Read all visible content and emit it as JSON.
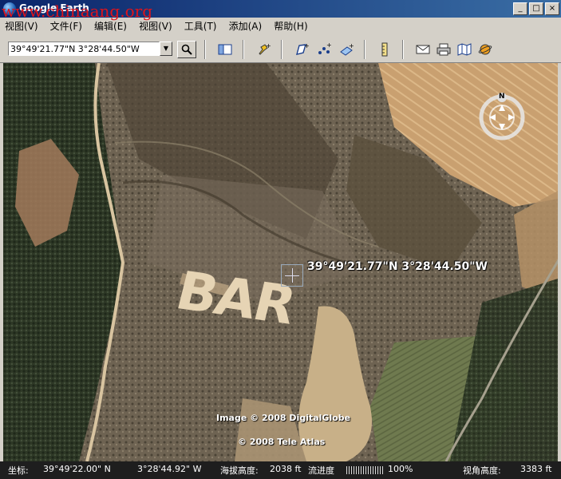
{
  "window": {
    "title": "Google Earth",
    "watermark": "www.chinaang.org",
    "buttons": {
      "minimize": "_",
      "maximize": "□",
      "close": "×"
    }
  },
  "menu": [
    "视图(V)",
    "文件(F)",
    "编辑(E)",
    "视图(V)",
    "工具(T)",
    "添加(A)",
    "帮助(H)"
  ],
  "search": {
    "value": "39°49'21.77\"N 3°28'44.50\"W"
  },
  "map": {
    "ground_text": "BAR",
    "cursor_coords": "39°49'21.77\"N 3°28'44.50\"W",
    "credit_image": "Image © 2008 DigitalGlobe",
    "credit_atlas": "© 2008 Tele Atlas",
    "compass_north": "N"
  },
  "status": {
    "coord_label": "坐标:",
    "lat": "39°49'22.00\" N",
    "lon": "3°28'44.92\" W",
    "elev_label": "海拔高度:",
    "elev": "2038 ft",
    "stream_label": "流进度",
    "stream_pct": "100%",
    "eye_label": "视角高度:",
    "eye": "3383 ft"
  },
  "colors": {
    "accent": "#0a246a",
    "field": "#c9a070",
    "forest": "#2f3a24"
  }
}
